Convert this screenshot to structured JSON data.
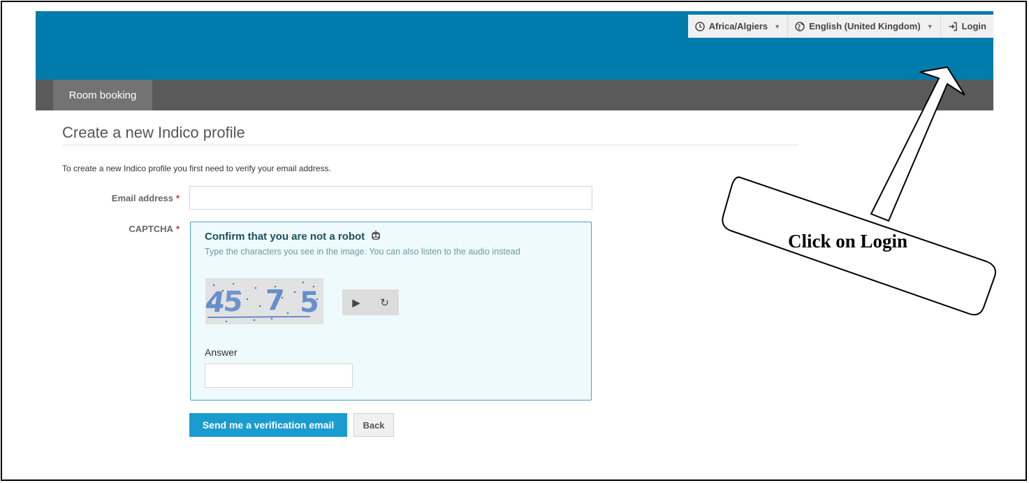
{
  "topbar": {
    "timezone": "Africa/Algiers",
    "language": "English (United Kingdom)",
    "login": "Login",
    "color": "#007cac"
  },
  "navbar": {
    "tab": "Room booking"
  },
  "page": {
    "title": "Create a new Indico profile",
    "intro": "To create a new Indico profile you first need to verify your email address."
  },
  "form": {
    "email_label": "Email address",
    "captcha_label": "CAPTCHA",
    "required_mark": "*",
    "captcha": {
      "title": "Confirm that you are not a robot",
      "subtitle": "Type the characters you see in the image. You can also listen to the audio instead",
      "image_text": "45 7 5",
      "answer_label": "Answer"
    },
    "submit": "Send me a verification email",
    "back": "Back"
  },
  "annotation": {
    "text": "Click on Login"
  }
}
